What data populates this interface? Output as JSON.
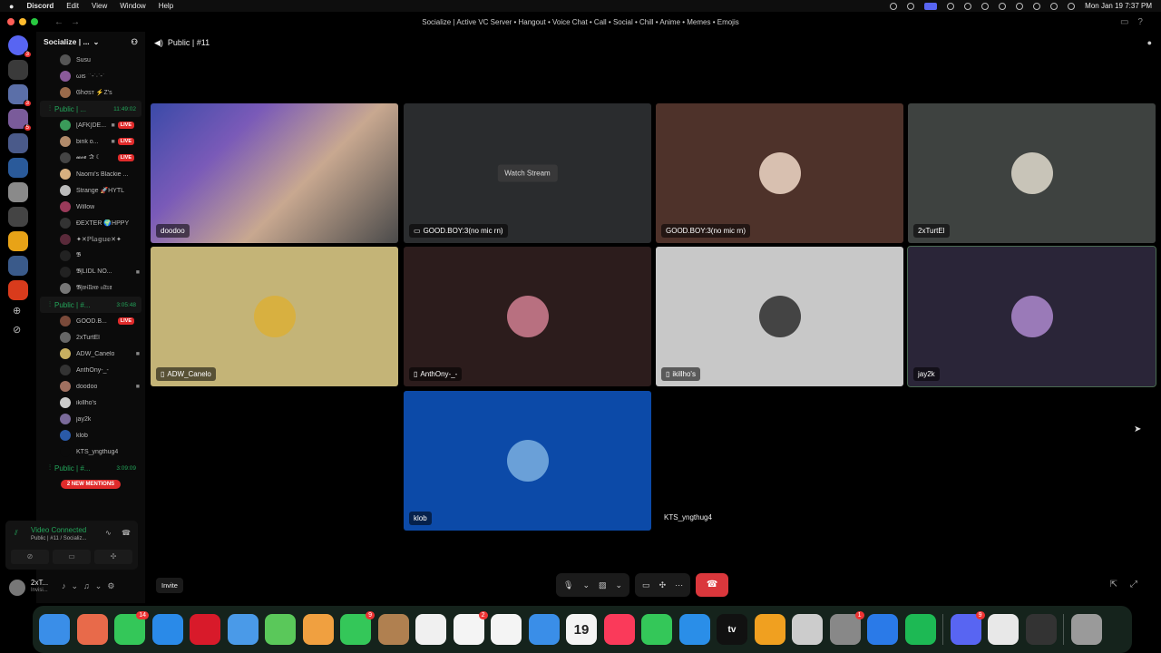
{
  "menubar": {
    "app": "Discord",
    "items": [
      "Edit",
      "View",
      "Window",
      "Help"
    ],
    "clock": "Mon Jan 19  7:37 PM"
  },
  "window": {
    "title": "Socialize | Active VC Server • Hangout • Voice Chat • Call • Social • Chill • Anime • Memes • Emojis"
  },
  "servers": [
    {
      "color": "#5865f2",
      "badge": "3"
    },
    {
      "color": "#3a3a3a",
      "badge": ""
    },
    {
      "color": "#5b6fa8",
      "badge": "3"
    },
    {
      "color": "#7a5b9a",
      "badge": "5"
    },
    {
      "color": "#4a5a8a",
      "badge": ""
    },
    {
      "color": "#2a5a9a",
      "badge": ""
    },
    {
      "color": "#8a8a8a",
      "badge": ""
    },
    {
      "color": "#444444",
      "badge": ""
    },
    {
      "color": "#e8a317",
      "badge": ""
    },
    {
      "color": "#3a5a8a",
      "badge": ""
    },
    {
      "color": "#d93b1c",
      "badge": ""
    }
  ],
  "sidebar": {
    "server_name": "Socialize | ...",
    "top_users": [
      {
        "name": "Susu",
        "color": "#555"
      },
      {
        "name": "ωιѕ ˙ˊ-ˋ·ˊ-ˋ",
        "color": "#8a5a9a"
      },
      {
        "name": "Ꮆhσѕт ⚡Z's",
        "color": "#9a6a4a"
      }
    ],
    "channel1": {
      "name": "Public | ...",
      "time": "11:49:02"
    },
    "users1": [
      {
        "name": "[AFK]DE...",
        "color": "#3a9a5a",
        "live": "LIVE",
        "cam": true
      },
      {
        "name": "bink o...",
        "color": "#b08a6a",
        "live": "LIVE",
        "cam": true
      },
      {
        "name": "𝔀𝓸𝓮 ✰ ☾",
        "color": "#444",
        "live": "LIVE",
        "cam": false
      },
      {
        "name": "Naomi's Blackie ...",
        "color": "#d8b080",
        "live": "",
        "cam": false
      },
      {
        "name": "Strange 🚀HYTL",
        "color": "#bbb",
        "live": "",
        "cam": false
      },
      {
        "name": "Willow",
        "color": "#9a3a5a",
        "live": "",
        "cam": false
      },
      {
        "name": "ÐEXTER 🌍HPPY",
        "color": "#333",
        "live": "",
        "cam": false
      },
      {
        "name": "✦✕ℙ𝕝𝕒𝕘𝕦𝕖✕✦",
        "color": "#5a2a3a",
        "live": "",
        "cam": false
      },
      {
        "name": "𝕭",
        "color": "#222",
        "live": "",
        "cam": false
      },
      {
        "name": "𝕭|LIDL NO...",
        "color": "#222",
        "live": "",
        "cam": true
      },
      {
        "name": "𝕭|𝔴𝔦𝔩𝔩𝔬𝔴 𝔲𝔩𝔱𝔯𝔞",
        "color": "#777",
        "live": "",
        "cam": false
      }
    ],
    "channel2": {
      "name": "Public | #...",
      "time": "3:05:48"
    },
    "users2": [
      {
        "name": "GOOD.B...",
        "color": "#7a4a3a",
        "live": "LIVE",
        "cam": false
      },
      {
        "name": "2xTurtEl",
        "color": "#666",
        "live": "",
        "cam": false
      },
      {
        "name": "ADW_Canelo",
        "color": "#c8b060",
        "live": "",
        "cam": true
      },
      {
        "name": "AnthOny-_-",
        "color": "#333",
        "live": "",
        "cam": false
      },
      {
        "name": "doodoo",
        "color": "#a07060",
        "live": "",
        "cam": true
      },
      {
        "name": "ikillho's",
        "color": "#ccc",
        "live": "",
        "cam": false
      },
      {
        "name": "jay2k",
        "color": "#7a6a9a",
        "live": "",
        "cam": false
      },
      {
        "name": "klob",
        "color": "#2a5aa8",
        "live": "",
        "cam": false
      },
      {
        "name": "KTS_yngthug4",
        "color": "#0b0b0b",
        "live": "",
        "cam": false
      }
    ],
    "channel3": {
      "name": "Public | #...",
      "time": "3:09:09"
    },
    "mentions": "2 NEW MENTIONS"
  },
  "voice_panel": {
    "status": "Video Connected",
    "channel": "Public | #11 / Socializ..."
  },
  "user_panel": {
    "name": "2xT...",
    "status": "Invisi..."
  },
  "stage": {
    "channel": "Public | #11",
    "invite": "Invite",
    "watch_stream": "Watch Stream",
    "tiles": [
      {
        "name": "doodoo",
        "bg": "#3a3a4a",
        "avatar": "",
        "device": ""
      },
      {
        "name": "GOOD.BOY:3(no mic rn)",
        "bg": "#2a2c2e",
        "avatar": "",
        "device": "screen"
      },
      {
        "name": "GOOD.BOY:3(no mic rn)",
        "bg": "#4e322a",
        "avatar": "#d8c0b0",
        "device": ""
      },
      {
        "name": "2xTurtEl",
        "bg": "#3e4240",
        "avatar": "#c8c4b8",
        "device": ""
      },
      {
        "name": "ADW_Canelo",
        "bg": "#c4b477",
        "avatar": "#d8b040",
        "device": "mobile"
      },
      {
        "name": "AnthOny-_-",
        "bg": "#2c1c1c",
        "avatar": "#b87080",
        "device": "mobile"
      },
      {
        "name": "ikillho's",
        "bg": "#c8c8c8",
        "avatar": "#444444",
        "device": "mobile"
      },
      {
        "name": "jay2k",
        "bg": "#2a2538",
        "avatar": "#9a7ab8",
        "device": ""
      },
      {
        "name": "klob",
        "bg": "#0c4aa8",
        "avatar": "#6aa0d8",
        "device": ""
      }
    ],
    "extra_participant": "KTS_yngthug4"
  },
  "dock": [
    {
      "app": "Finder",
      "color": "#3a8ee8",
      "badge": ""
    },
    {
      "app": "Launchpad",
      "color": "#e86a4a",
      "badge": ""
    },
    {
      "app": "Messages",
      "color": "#34c759",
      "badge": "14"
    },
    {
      "app": "Safari",
      "color": "#2a8ae8",
      "badge": ""
    },
    {
      "app": "Opera",
      "color": "#d81a2a",
      "badge": ""
    },
    {
      "app": "Mail",
      "color": "#4a9ae8",
      "badge": ""
    },
    {
      "app": "Maps",
      "color": "#5ac85a",
      "badge": ""
    },
    {
      "app": "Photos",
      "color": "#f0a040",
      "badge": ""
    },
    {
      "app": "FaceTime",
      "color": "#34c759",
      "badge": "9"
    },
    {
      "app": "Contacts",
      "color": "#b08050",
      "badge": ""
    },
    {
      "app": "Freeform",
      "color": "#f0f0f0",
      "badge": ""
    },
    {
      "app": "Reminders",
      "color": "#f4f4f4",
      "badge": "2"
    },
    {
      "app": "News",
      "color": "#f4f4f4",
      "badge": ""
    },
    {
      "app": "Keynote",
      "color": "#3a8ee8",
      "badge": ""
    },
    {
      "app": "Calendar",
      "color": "#f4f4f4",
      "badge": "",
      "text": "19"
    },
    {
      "app": "Music",
      "color": "#fa3a5a",
      "badge": ""
    },
    {
      "app": "Numbers",
      "color": "#34c759",
      "badge": ""
    },
    {
      "app": "App Store",
      "color": "#2a8ee8",
      "badge": ""
    },
    {
      "app": "TV",
      "color": "#111111",
      "badge": "",
      "text": "tv"
    },
    {
      "app": "Pages",
      "color": "#f0a020",
      "badge": ""
    },
    {
      "app": "iPhone Mirroring",
      "color": "#ccc",
      "badge": ""
    },
    {
      "app": "System Settings",
      "color": "#888",
      "badge": "1"
    },
    {
      "app": "Roblox",
      "color": "#2a7ae8",
      "badge": ""
    },
    {
      "app": "Spotify",
      "color": "#1db954",
      "badge": ""
    },
    {
      "app": "Discord",
      "color": "#5865f2",
      "badge": "9"
    },
    {
      "app": "Chrome",
      "color": "#e8e8e8",
      "badge": ""
    },
    {
      "app": "OBS",
      "color": "#333",
      "badge": ""
    },
    {
      "app": "Trash",
      "color": "#9a9a9a",
      "badge": ""
    }
  ]
}
